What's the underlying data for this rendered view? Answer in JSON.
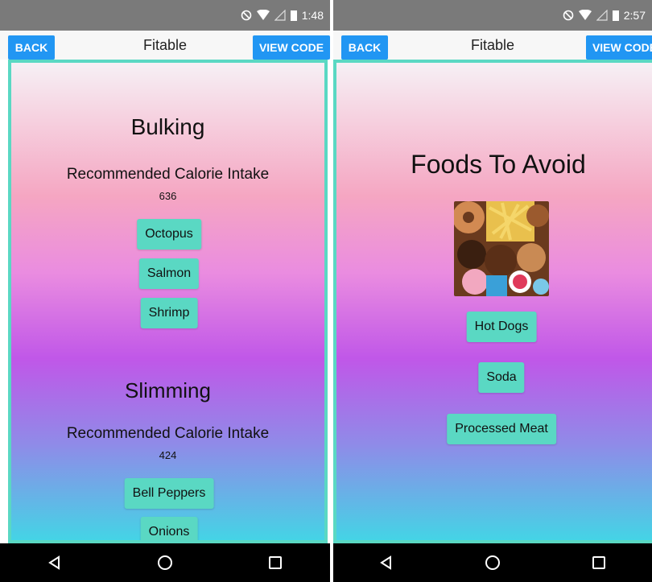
{
  "left": {
    "status": {
      "time": "1:48"
    },
    "app": {
      "back_label": "BACK",
      "title": "Fitable",
      "view_code_label": "VIEW CODE"
    },
    "bulking": {
      "title": "Bulking",
      "calorie_label": "Recommended Calorie Intake",
      "calorie_value": "636",
      "foods": [
        "Octopus",
        "Salmon",
        "Shrimp"
      ]
    },
    "slimming": {
      "title": "Slimming",
      "calorie_label": "Recommended Calorie Intake",
      "calorie_value": "424",
      "foods": [
        "Bell Peppers",
        "Onions"
      ]
    }
  },
  "right": {
    "status": {
      "time": "2:57"
    },
    "app": {
      "back_label": "BACK",
      "title": "Fitable",
      "view_code_label": "VIEW CODE"
    },
    "avoid": {
      "title": "Foods To Avoid",
      "image_icon": "junk-food-image",
      "foods": [
        "Hot Dogs",
        "Soda",
        "Processed Meat"
      ]
    }
  },
  "nav": {
    "back_icon": "triangle-back-icon",
    "home_icon": "circle-home-icon",
    "recents_icon": "square-recents-icon"
  },
  "colors": {
    "accent_chip": "#5ad8c3",
    "top_button": "#2196f3",
    "status_bar": "#7a7a7a"
  }
}
